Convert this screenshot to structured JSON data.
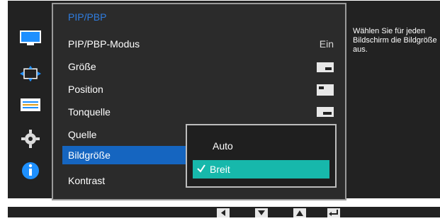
{
  "menu": {
    "title": "PIP/PBP",
    "items": [
      {
        "label": "PIP/PBP-Modus",
        "value": "Ein"
      },
      {
        "label": "Größe"
      },
      {
        "label": "Position"
      },
      {
        "label": "Tonquelle"
      },
      {
        "label": "Quelle"
      },
      {
        "label": "Bildgröße",
        "selected": true
      },
      {
        "label": "Kontrast"
      }
    ]
  },
  "submenu": {
    "options": [
      "Auto",
      "Breit"
    ],
    "selected": "Breit"
  },
  "help": {
    "text": "Wählen Sie für jeden Bildschirm die Bildgröße aus."
  },
  "sidebar": {
    "icons": [
      "picture-icon",
      "move-arrows-icon",
      "display-settings-icon",
      "gear-icon",
      "info-icon"
    ]
  },
  "colors": {
    "highlight_blue": "#1565c0",
    "title_blue": "#2f7de0",
    "option_teal": "#17b8ab"
  }
}
